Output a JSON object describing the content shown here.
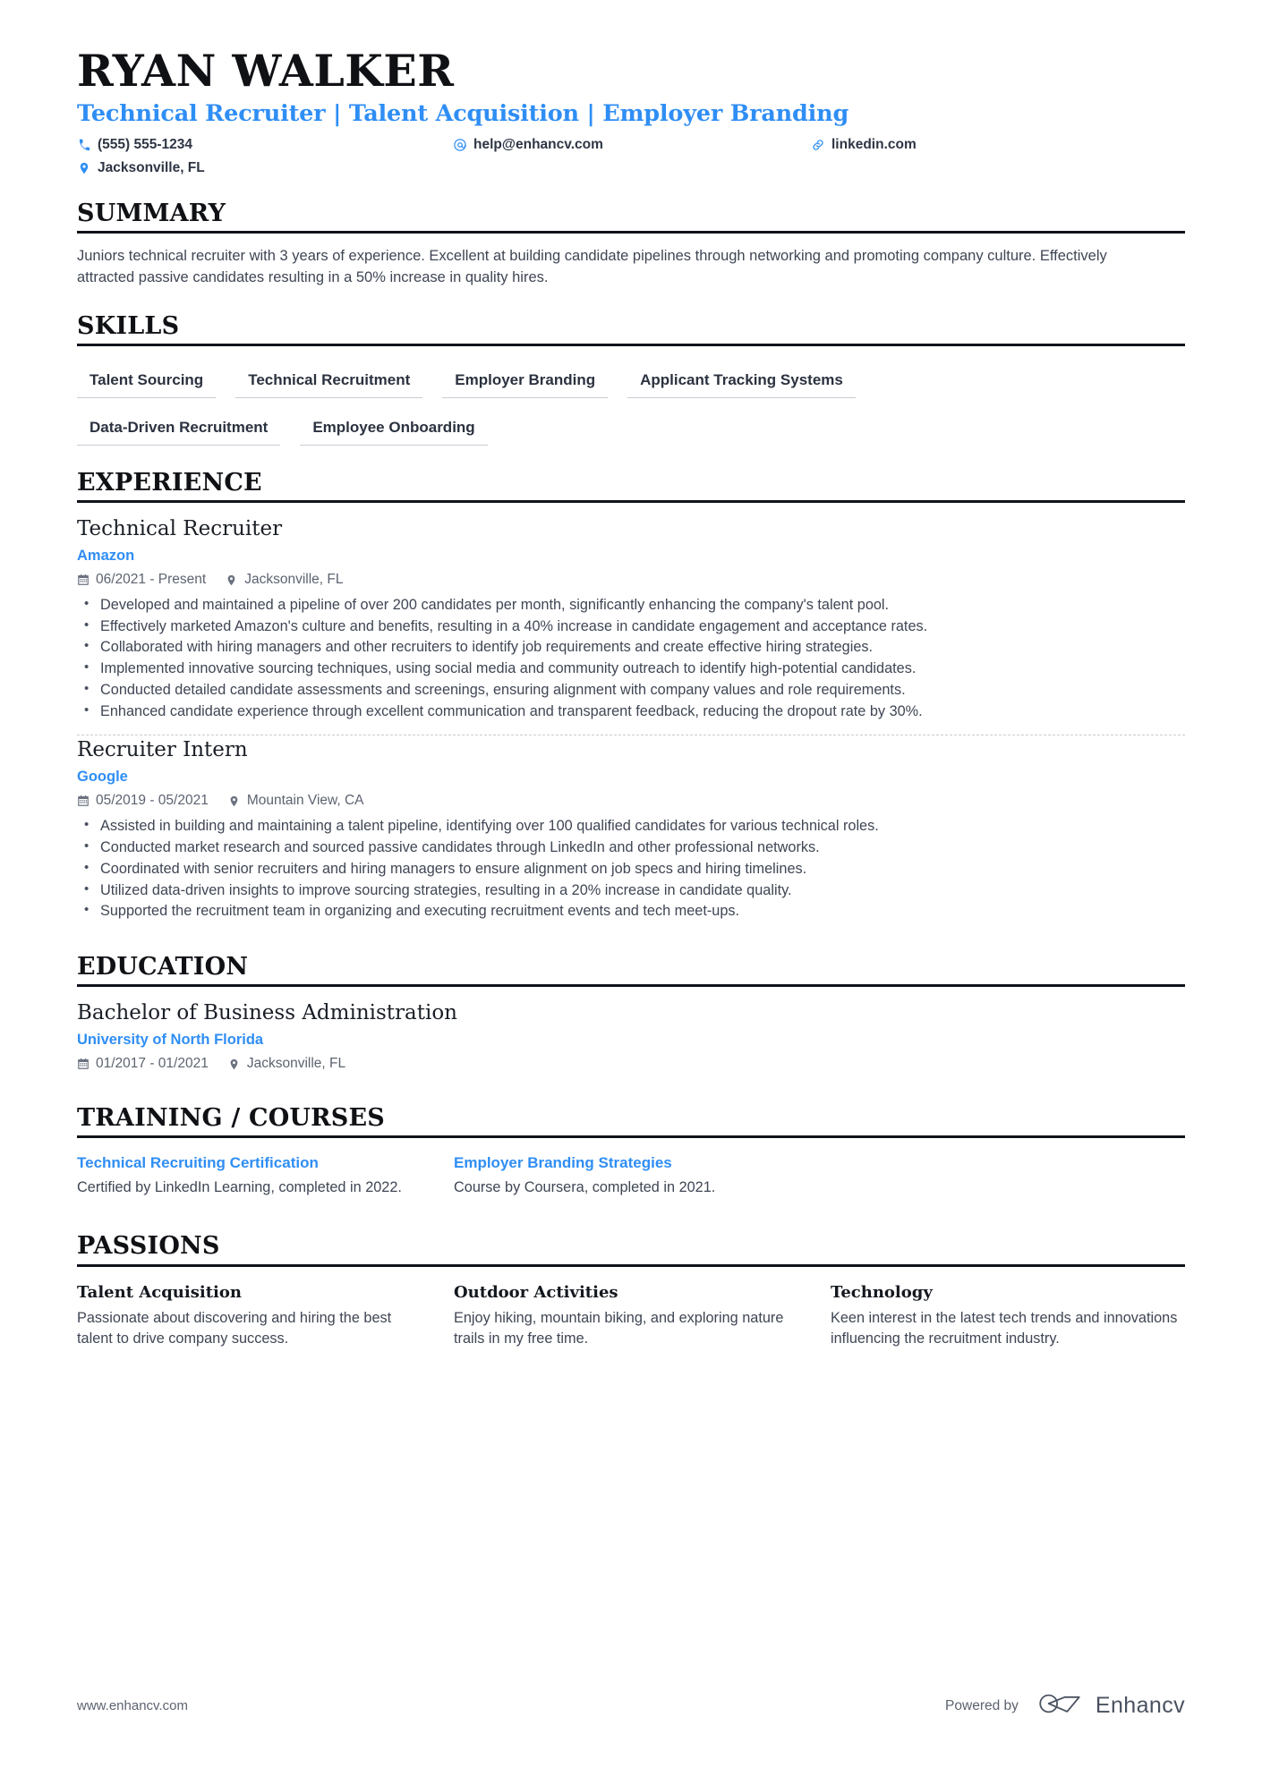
{
  "header": {
    "full_name": "Ryan Walker",
    "job_title": "Technical Recruiter | Talent Acquisition | Employer Branding",
    "contacts": [
      {
        "icon": "phone-icon",
        "text": "(555) 555-1234"
      },
      {
        "icon": "email-icon",
        "text": "help@enhancv.com"
      },
      {
        "icon": "link-icon",
        "text": "linkedin.com"
      },
      {
        "icon": "location-pin-icon",
        "text": "Jacksonville, FL"
      }
    ]
  },
  "summary": {
    "section_title": "Summary",
    "text": "Juniors technical recruiter with 3 years of experience. Excellent at building candidate pipelines through networking and promoting company culture. Effectively attracted passive candidates resulting in a 50% increase in quality hires."
  },
  "skills": {
    "section_title": "Skills",
    "items": [
      "Talent Sourcing",
      "Technical Recruitment",
      "Employer Branding",
      "Applicant Tracking Systems",
      "Data-Driven Recruitment",
      "Employee Onboarding"
    ]
  },
  "experience": {
    "section_title": "Experience",
    "entries": [
      {
        "title": "Technical Recruiter",
        "organization": "Amazon",
        "dates": "06/2021 - Present",
        "location": "Jacksonville, FL",
        "bullets": [
          "Developed and maintained a pipeline of over 200 candidates per month, significantly enhancing the company's talent pool.",
          "Effectively marketed Amazon's culture and benefits, resulting in a 40% increase in candidate engagement and acceptance rates.",
          "Collaborated with hiring managers and other recruiters to identify job requirements and create effective hiring strategies.",
          "Implemented innovative sourcing techniques, using social media and community outreach to identify high-potential candidates.",
          "Conducted detailed candidate assessments and screenings, ensuring alignment with company values and role requirements.",
          "Enhanced candidate experience through excellent communication and transparent feedback, reducing the dropout rate by 30%."
        ]
      },
      {
        "title": "Recruiter Intern",
        "organization": "Google",
        "dates": "05/2019 - 05/2021",
        "location": "Mountain View, CA",
        "bullets": [
          "Assisted in building and maintaining a talent pipeline, identifying over 100 qualified candidates for various technical roles.",
          "Conducted market research and sourced passive candidates through LinkedIn and other professional networks.",
          "Coordinated with senior recruiters and hiring managers to ensure alignment on job specs and hiring timelines.",
          "Utilized data-driven insights to improve sourcing strategies, resulting in a 20% increase in candidate quality.",
          "Supported the recruitment team in organizing and executing recruitment events and tech meet-ups."
        ]
      }
    ]
  },
  "education": {
    "section_title": "Education",
    "entries": [
      {
        "title": "Bachelor of Business Administration",
        "organization": "University of North Florida",
        "dates": "01/2017 - 01/2021",
        "location": "Jacksonville, FL"
      }
    ]
  },
  "training": {
    "section_title": "Training / Courses",
    "items": [
      {
        "title": "Technical Recruiting Certification",
        "description": "Certified by LinkedIn Learning, completed in 2022."
      },
      {
        "title": "Employer Branding Strategies",
        "description": "Course by Coursera, completed in 2021."
      }
    ]
  },
  "passions": {
    "section_title": "Passions",
    "items": [
      {
        "title": "Talent Acquisition",
        "description": "Passionate about discovering and hiring the best talent to drive company success."
      },
      {
        "title": "Outdoor Activities",
        "description": "Enjoy hiking, mountain biking, and exploring nature trails in my free time."
      },
      {
        "title": "Technology",
        "description": "Keen interest in the latest tech trends and innovations influencing the recruitment industry."
      }
    ]
  },
  "footer": {
    "url": "www.enhancv.com",
    "powered_by": "Powered by",
    "brand_name": "Enhancv"
  },
  "colors": {
    "accent": "#2f8ef4",
    "heading": "#0f1115",
    "body_text": "#3f4654",
    "rule": "#10131a",
    "muted": "#5c6370"
  }
}
